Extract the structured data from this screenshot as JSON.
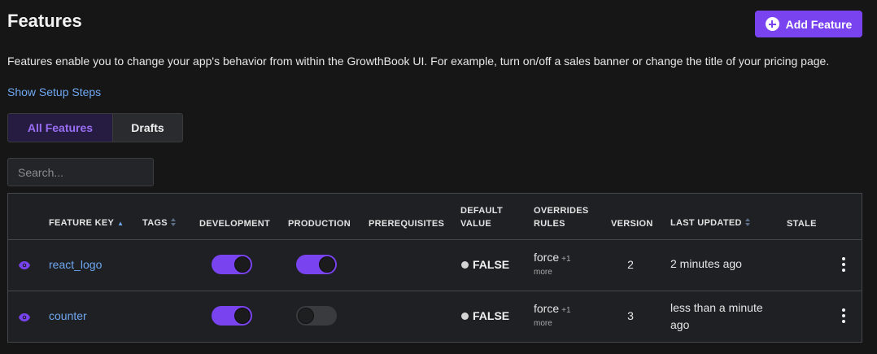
{
  "header": {
    "title": "Features",
    "add_button_label": "Add Feature"
  },
  "description": "Features enable you to change your app's behavior from within the GrowthBook UI. For example, turn on/off a sales banner or change the title of your pricing page.",
  "setup_link": "Show Setup Steps",
  "tabs": [
    {
      "label": "All Features",
      "active": true
    },
    {
      "label": "Drafts",
      "active": false
    }
  ],
  "search": {
    "placeholder": "Search...",
    "value": ""
  },
  "table": {
    "columns": {
      "feature_key": "FEATURE KEY",
      "tags": "TAGS",
      "development": "DEVELOPMENT",
      "production": "PRODUCTION",
      "prerequisites": "PREREQUISITES",
      "default_value_1": "DEFAULT",
      "default_value_2": "VALUE",
      "overrides_1": "OVERRIDES",
      "overrides_2": "RULES",
      "version": "VERSION",
      "last_updated": "LAST UPDATED",
      "stale": "STALE"
    },
    "rows": [
      {
        "key": "react_logo",
        "development": true,
        "production": true,
        "default_value": "FALSE",
        "override_type": "force",
        "override_count": "+1",
        "override_more": "more",
        "version": "2",
        "updated_line1": "2 minutes ago",
        "updated_line2": ""
      },
      {
        "key": "counter",
        "development": true,
        "production": false,
        "default_value": "FALSE",
        "override_type": "force",
        "override_count": "+1",
        "override_more": "more",
        "version": "3",
        "updated_line1": "less than a minute",
        "updated_line2": "ago"
      }
    ]
  },
  "colors": {
    "accent": "#7a43f0",
    "link": "#6fa8f2",
    "background": "#161616"
  }
}
